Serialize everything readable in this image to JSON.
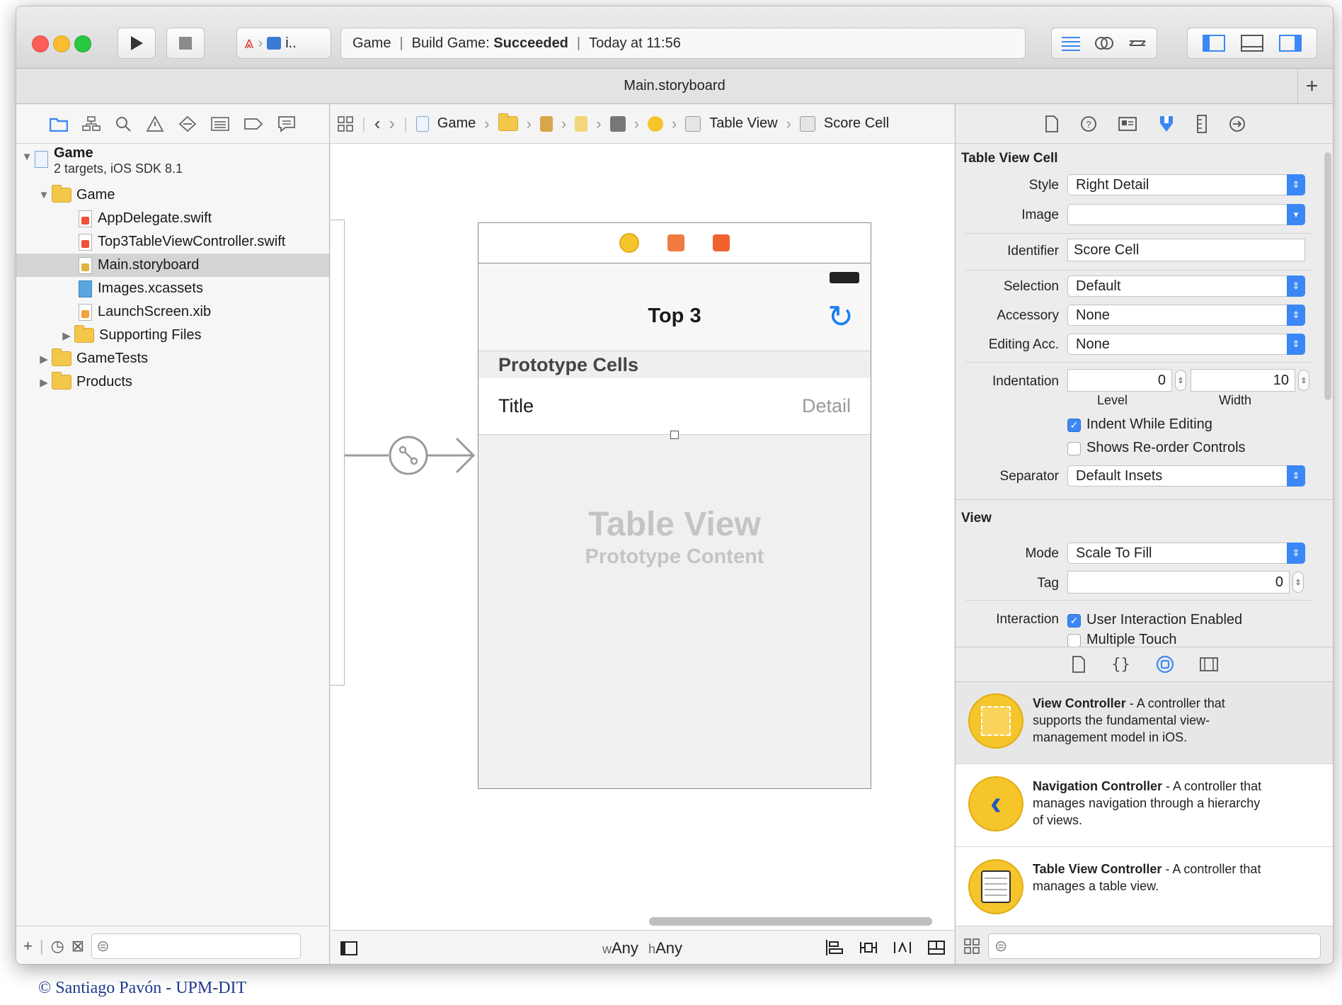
{
  "window": {
    "title": "Main.storyboard",
    "scheme_label": "i..",
    "activity": {
      "project": "Game",
      "build_prefix": "Build Game:",
      "build_status": "Succeeded",
      "time": "Today at 11:56"
    }
  },
  "navigator": {
    "project_name": "Game",
    "project_subtitle": "2 targets, iOS SDK 8.1",
    "items": [
      {
        "label": "Game"
      },
      {
        "label": "AppDelegate.swift"
      },
      {
        "label": "Top3TableViewController.swift"
      },
      {
        "label": "Main.storyboard"
      },
      {
        "label": "Images.xcassets"
      },
      {
        "label": "LaunchScreen.xib"
      },
      {
        "label": "Supporting Files"
      },
      {
        "label": "GameTests"
      },
      {
        "label": "Products"
      }
    ]
  },
  "jumpbar": {
    "crumbs": [
      "Game",
      "Table View",
      "Score Cell"
    ]
  },
  "canvas": {
    "nav_title": "Top 3",
    "prototype_header": "Prototype Cells",
    "cell_title": "Title",
    "cell_detail": "Detail",
    "placeholder_title": "Table View",
    "placeholder_subtitle": "Prototype Content"
  },
  "editor_bottom": {
    "w_prefix": "w",
    "w_value": "Any",
    "h_prefix": "h",
    "h_value": "Any"
  },
  "inspector": {
    "section_cell": "Table View Cell",
    "style_label": "Style",
    "style_value": "Right Detail",
    "image_label": "Image",
    "image_value": "",
    "identifier_label": "Identifier",
    "identifier_value": "Score Cell",
    "selection_label": "Selection",
    "selection_value": "Default",
    "accessory_label": "Accessory",
    "accessory_value": "None",
    "editing_acc_label": "Editing Acc.",
    "editing_acc_value": "None",
    "indentation_label": "Indentation",
    "level_value": "0",
    "level_caption": "Level",
    "width_value": "10",
    "width_caption": "Width",
    "indent_while_editing": "Indent While Editing",
    "shows_reorder": "Shows Re-order Controls",
    "separator_label": "Separator",
    "separator_value": "Default Insets",
    "section_view": "View",
    "mode_label": "Mode",
    "mode_value": "Scale To Fill",
    "tag_label": "Tag",
    "tag_value": "0",
    "interaction_label": "Interaction",
    "user_interaction": "User Interaction Enabled",
    "multiple_touch": "Multiple Touch"
  },
  "library": {
    "items": [
      {
        "name": "View Controller",
        "desc": " - A controller that supports the fundamental view-management model in iOS."
      },
      {
        "name": "Navigation Controller",
        "desc": " - A controller that manages navigation through a hierarchy of views."
      },
      {
        "name": "Table View Controller",
        "desc": " - A controller that manages a table view."
      }
    ]
  },
  "footer": {
    "copyright": "© Santiago Pavón - UPM-DIT"
  },
  "colors": {
    "accent": "#3b87f5",
    "library_icon": "#f6c52b",
    "swift": "#f05138"
  }
}
